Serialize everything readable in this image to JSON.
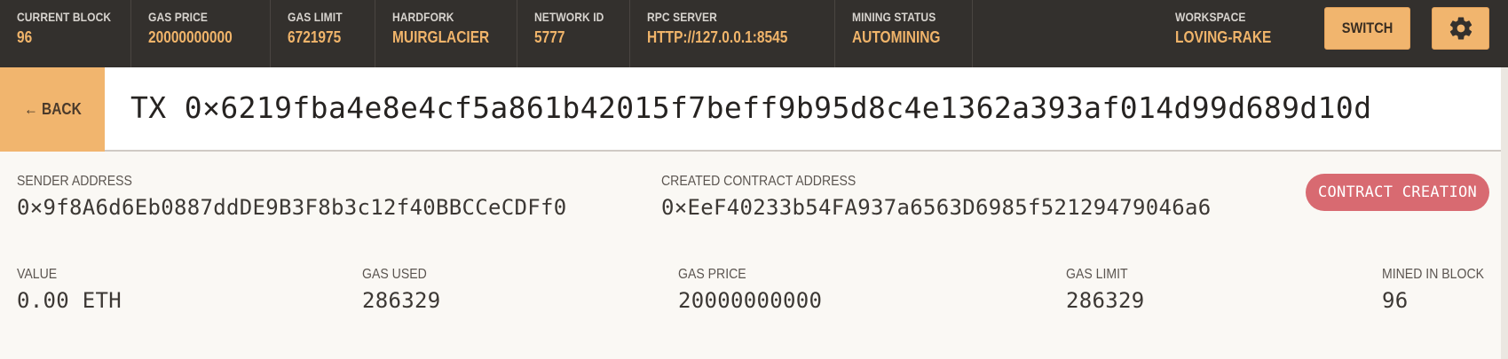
{
  "header": {
    "stats": [
      {
        "label": "CURRENT BLOCK",
        "value": "96"
      },
      {
        "label": "GAS PRICE",
        "value": "20000000000"
      },
      {
        "label": "GAS LIMIT",
        "value": "6721975"
      },
      {
        "label": "HARDFORK",
        "value": "MUIRGLACIER"
      },
      {
        "label": "NETWORK ID",
        "value": "5777"
      },
      {
        "label": "RPC SERVER",
        "value": "HTTP://127.0.0.1:8545"
      },
      {
        "label": "MINING STATUS",
        "value": "AUTOMINING"
      }
    ],
    "workspace_label": "WORKSPACE",
    "workspace_value": "LOVING-RAKE",
    "switch_label": "SWITCH",
    "settings_icon": "gear-icon"
  },
  "title_bar": {
    "back_label": "← BACK",
    "tx_title": "TX 0×6219fba4e8e4cf5a861b42015f7beff9b95d8c4e1362a393af014d99d689d10d"
  },
  "details": {
    "sender_label": "SENDER ADDRESS",
    "sender_value": "0×9f8A6d6Eb0887ddDE9B3F8b3c12f40BBCCeCDFf0",
    "contract_label": "CREATED CONTRACT ADDRESS",
    "contract_value": "0×EeF40233b54FA937a6563D6985f52129479046a6",
    "badge": "CONTRACT CREATION",
    "value_label": "VALUE",
    "value_value": "0.00 ETH",
    "gas_used_label": "GAS USED",
    "gas_used_value": "286329",
    "gas_price_label": "GAS PRICE",
    "gas_price_value": "20000000000",
    "gas_limit_label": "GAS LIMIT",
    "gas_limit_value": "286329",
    "mined_label": "MINED IN BLOCK",
    "mined_value": "96"
  },
  "colors": {
    "header_bg": "#33302d",
    "accent": "#f1b56e",
    "accent_text": "#f0b46a",
    "badge_bg": "#d86a71",
    "page_bg": "#faf8f4"
  }
}
